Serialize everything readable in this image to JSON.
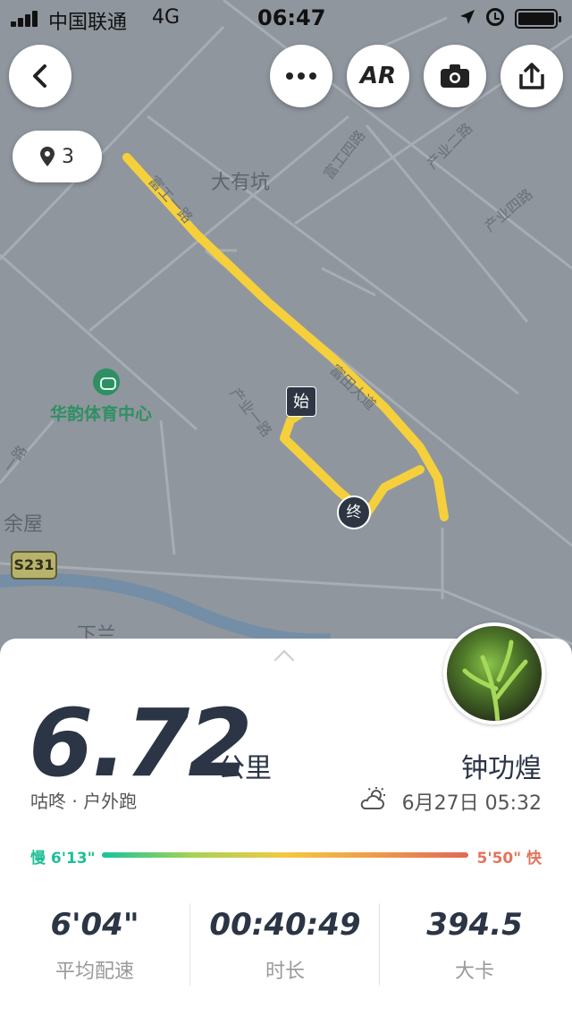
{
  "status_bar": {
    "carrier": "中国联通",
    "network": "4G",
    "time": "06:47"
  },
  "toolbar": {
    "ar_label": "AR"
  },
  "map": {
    "pin_count": "3",
    "places": [
      "大有坑",
      "华韵体育中心",
      "余屋",
      "下兰"
    ],
    "roads": [
      "富工四路",
      "产业二路",
      "产业四路",
      "产业一路",
      "富工一路",
      "富田大道",
      "一路"
    ],
    "highway_badge": "S231",
    "start_marker": "始",
    "end_marker": "终"
  },
  "summary": {
    "distance": "6.72",
    "unit": "公里",
    "username": "钟功煌",
    "sport_type": "咕咚 · 户外跑",
    "datetime": "6月27日 05:32",
    "pace_slow": "慢 6'13\"",
    "pace_fast": "5'50\" 快"
  },
  "stats": [
    {
      "value": "6'04\"",
      "label": "平均配速"
    },
    {
      "value": "00:40:49",
      "label": "时长"
    },
    {
      "value": "394.5",
      "label": "大卡"
    }
  ],
  "colors": {
    "route": "#f5d03c",
    "text_dark": "#2b3545",
    "pace_slow": "#1fbf96",
    "pace_fast": "#e2745c"
  }
}
